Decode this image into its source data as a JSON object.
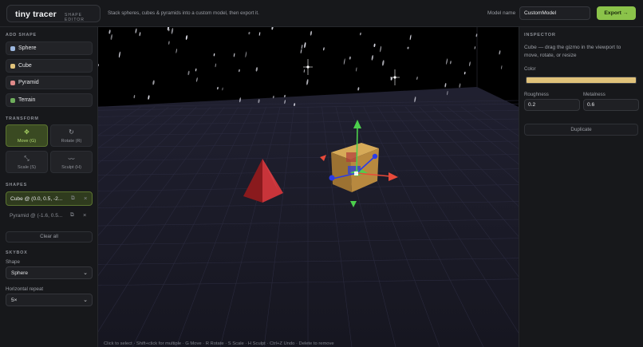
{
  "header": {
    "brand_title": "tiny tracer",
    "brand_subtitle": "SHAPE EDITOR",
    "tagline": "Stack spheres, cubes & pyramids into a custom model, then export it.",
    "model_name_label": "Model name",
    "model_name_value": "CustomModel",
    "export_label": "Export →"
  },
  "sidebar": {
    "add_shape_heading": "ADD SHAPE",
    "shapes": [
      {
        "label": "Sphere",
        "color": "#9db8e0"
      },
      {
        "label": "Cube",
        "color": "#e0c27a"
      },
      {
        "label": "Pyramid",
        "color": "#e08a8a"
      },
      {
        "label": "Terrain",
        "color": "#6fae5c"
      }
    ],
    "transform_heading": "TRANSFORM",
    "tools": [
      {
        "label": "Move (G)",
        "icon": "move-icon",
        "glyph": "✥",
        "active": true
      },
      {
        "label": "Rotate (R)",
        "icon": "rotate-icon",
        "glyph": "↻",
        "active": false
      },
      {
        "label": "Scale (S)",
        "icon": "scale-icon",
        "glyph": "⤡",
        "active": false
      },
      {
        "label": "Sculpt (H)",
        "icon": "sculpt-icon",
        "glyph": "〰",
        "active": false
      }
    ],
    "shapes_heading": "SHAPES",
    "shape_list": [
      {
        "label": "Cube @ (0.0, 0.5, -2...",
        "selected": true
      },
      {
        "label": "Pyramid @ (-1.6, 0.5...",
        "selected": false
      }
    ],
    "clear_all_label": "Clear all",
    "skybox_heading": "SKYBOX",
    "skybox_shape_label": "Shape",
    "skybox_shape_value": "Sphere",
    "horizontal_repeat_label": "Horizontal repeat",
    "horizontal_repeat_value": "5×"
  },
  "viewport": {
    "hint": "Click to select · Shift+click for multiple · G Move · R Rotate · S Scale · H Sculpt · Ctrl+Z Undo · Delete to remove",
    "cube_color": "#c89a4a",
    "pyramid_color": "#b3262b",
    "gizmo_colors": {
      "x": "#e84a3a",
      "y": "#4cd04c",
      "z": "#2a3be8"
    }
  },
  "inspector": {
    "title": "INSPECTOR",
    "description": "Cube — drag the gizmo in the viewport to move, rotate, or resize",
    "color_label": "Color",
    "color_value": "#e0c27a",
    "roughness_label": "Roughness",
    "roughness_value": "0.2",
    "metalness_label": "Metalness",
    "metalness_value": "0.6",
    "duplicate_label": "Duplicate"
  }
}
